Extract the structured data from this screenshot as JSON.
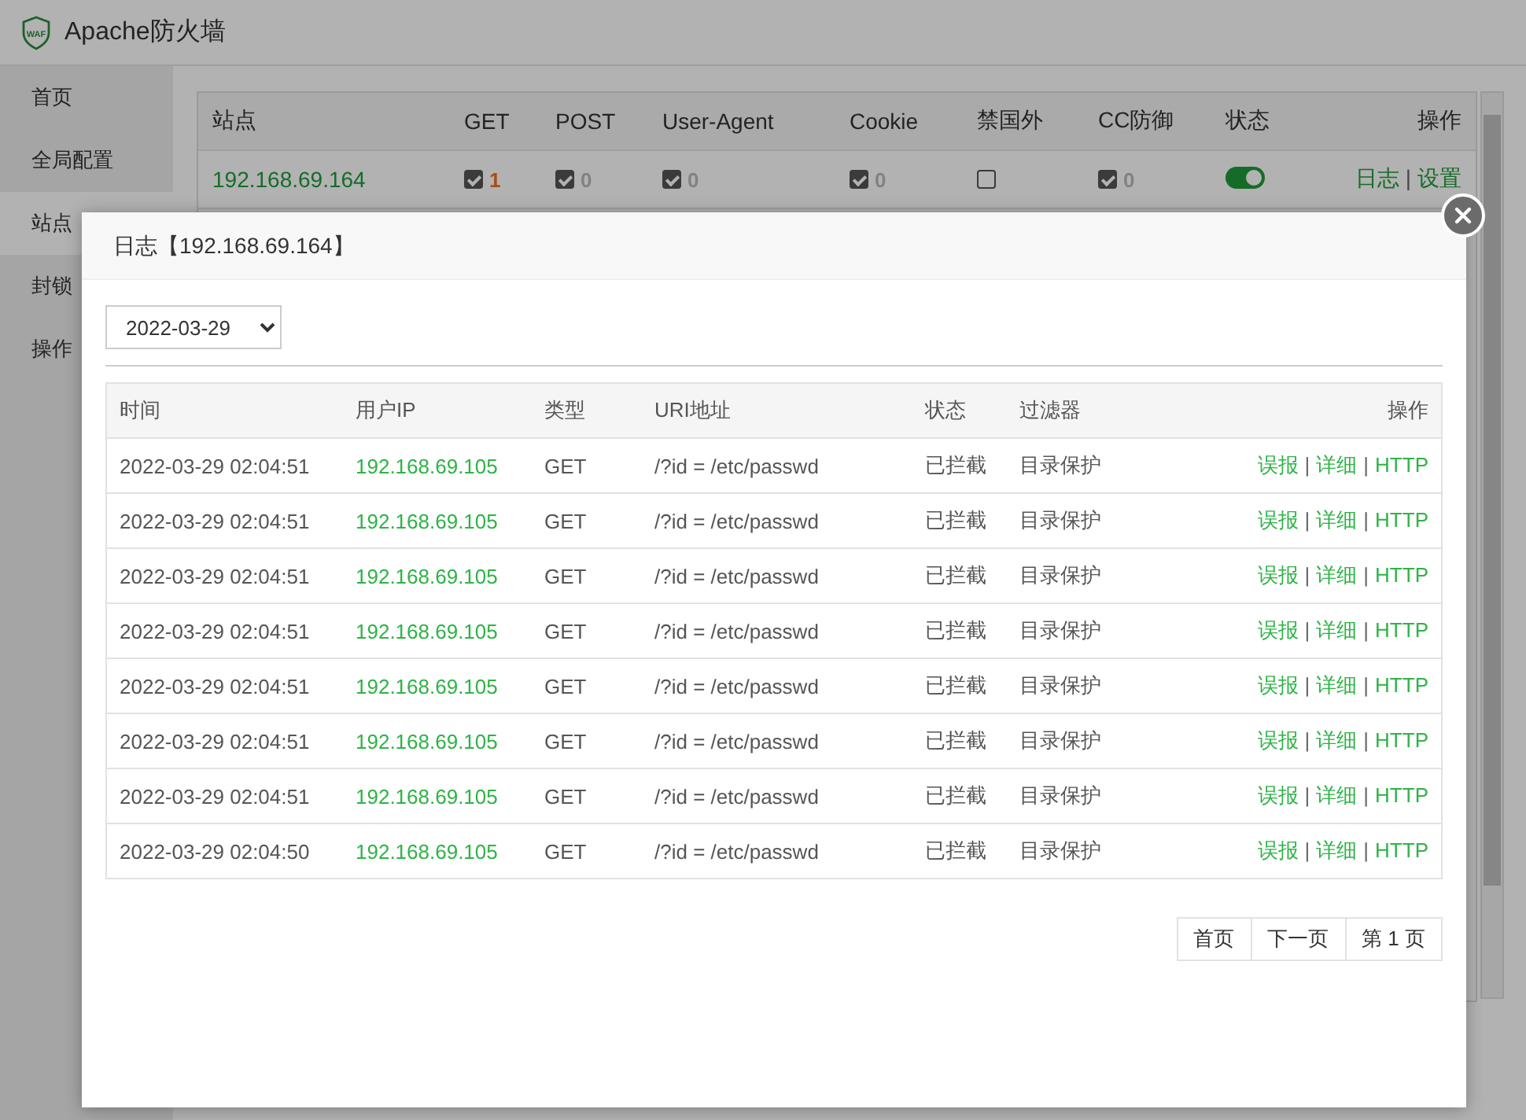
{
  "app": {
    "logo_text": "WAF",
    "title": "Apache防火墙"
  },
  "sidebar": {
    "items": [
      {
        "label": "首页",
        "selected": false
      },
      {
        "label": "全局配置",
        "selected": false
      },
      {
        "label": "站点",
        "selected": true
      },
      {
        "label": "封锁",
        "selected": false
      },
      {
        "label": "操作",
        "selected": false
      }
    ]
  },
  "sites_table": {
    "columns": [
      "站点",
      "GET",
      "POST",
      "User-Agent",
      "Cookie",
      "禁国外",
      "CC防御",
      "状态",
      "操作"
    ],
    "rows": [
      {
        "site": "192.168.69.164",
        "checks": [
          {
            "checked": true,
            "count": "1",
            "highlighted": true
          },
          {
            "checked": true,
            "count": "0",
            "highlighted": false
          },
          {
            "checked": true,
            "count": "0",
            "highlighted": false
          },
          {
            "checked": true,
            "count": "0",
            "highlighted": false
          },
          {
            "checked": false
          },
          {
            "checked": true,
            "count": "0",
            "highlighted": false
          }
        ],
        "enabled": true,
        "actions": [
          {
            "kind": "link",
            "text": "日志"
          },
          {
            "kind": "separator",
            "text": "|"
          },
          {
            "kind": "link",
            "text": "设置"
          }
        ]
      }
    ]
  },
  "dialog": {
    "title": "日志【192.168.69.164】",
    "date": "2022-03-29",
    "columns": [
      "时间",
      "用户IP",
      "类型",
      "URI地址",
      "状态",
      "过滤器",
      "操作"
    ],
    "rows": [
      {
        "time": "2022-03-29 02:04:51",
        "ip": "192.168.69.105",
        "type": "GET",
        "uri": "/?id = /etc/passwd",
        "status": "已拦截",
        "filter": "目录保护",
        "actions": [
          {
            "kind": "link",
            "text": "误报"
          },
          {
            "kind": "separator",
            "text": "|"
          },
          {
            "kind": "link",
            "text": "详细"
          },
          {
            "kind": "separator",
            "text": "|"
          },
          {
            "kind": "link",
            "text": "HTTP"
          }
        ]
      },
      {
        "time": "2022-03-29 02:04:51",
        "ip": "192.168.69.105",
        "type": "GET",
        "uri": "/?id = /etc/passwd",
        "status": "已拦截",
        "filter": "目录保护",
        "actions": [
          {
            "kind": "link",
            "text": "误报"
          },
          {
            "kind": "separator",
            "text": "|"
          },
          {
            "kind": "link",
            "text": "详细"
          },
          {
            "kind": "separator",
            "text": "|"
          },
          {
            "kind": "link",
            "text": "HTTP"
          }
        ]
      },
      {
        "time": "2022-03-29 02:04:51",
        "ip": "192.168.69.105",
        "type": "GET",
        "uri": "/?id = /etc/passwd",
        "status": "已拦截",
        "filter": "目录保护",
        "actions": [
          {
            "kind": "link",
            "text": "误报"
          },
          {
            "kind": "separator",
            "text": "|"
          },
          {
            "kind": "link",
            "text": "详细"
          },
          {
            "kind": "separator",
            "text": "|"
          },
          {
            "kind": "link",
            "text": "HTTP"
          }
        ]
      },
      {
        "time": "2022-03-29 02:04:51",
        "ip": "192.168.69.105",
        "type": "GET",
        "uri": "/?id = /etc/passwd",
        "status": "已拦截",
        "filter": "目录保护",
        "actions": [
          {
            "kind": "link",
            "text": "误报"
          },
          {
            "kind": "separator",
            "text": "|"
          },
          {
            "kind": "link",
            "text": "详细"
          },
          {
            "kind": "separator",
            "text": "|"
          },
          {
            "kind": "link",
            "text": "HTTP"
          }
        ]
      },
      {
        "time": "2022-03-29 02:04:51",
        "ip": "192.168.69.105",
        "type": "GET",
        "uri": "/?id = /etc/passwd",
        "status": "已拦截",
        "filter": "目录保护",
        "actions": [
          {
            "kind": "link",
            "text": "误报"
          },
          {
            "kind": "separator",
            "text": "|"
          },
          {
            "kind": "link",
            "text": "详细"
          },
          {
            "kind": "separator",
            "text": "|"
          },
          {
            "kind": "link",
            "text": "HTTP"
          }
        ]
      },
      {
        "time": "2022-03-29 02:04:51",
        "ip": "192.168.69.105",
        "type": "GET",
        "uri": "/?id = /etc/passwd",
        "status": "已拦截",
        "filter": "目录保护",
        "actions": [
          {
            "kind": "link",
            "text": "误报"
          },
          {
            "kind": "separator",
            "text": "|"
          },
          {
            "kind": "link",
            "text": "详细"
          },
          {
            "kind": "separator",
            "text": "|"
          },
          {
            "kind": "link",
            "text": "HTTP"
          }
        ]
      },
      {
        "time": "2022-03-29 02:04:51",
        "ip": "192.168.69.105",
        "type": "GET",
        "uri": "/?id = /etc/passwd",
        "status": "已拦截",
        "filter": "目录保护",
        "actions": [
          {
            "kind": "link",
            "text": "误报"
          },
          {
            "kind": "separator",
            "text": "|"
          },
          {
            "kind": "link",
            "text": "详细"
          },
          {
            "kind": "separator",
            "text": "|"
          },
          {
            "kind": "link",
            "text": "HTTP"
          }
        ]
      },
      {
        "time": "2022-03-29 02:04:50",
        "ip": "192.168.69.105",
        "type": "GET",
        "uri": "/?id = /etc/passwd",
        "status": "已拦截",
        "filter": "目录保护",
        "actions": [
          {
            "kind": "link",
            "text": "误报"
          },
          {
            "kind": "separator",
            "text": "|"
          },
          {
            "kind": "link",
            "text": "详细"
          },
          {
            "kind": "separator",
            "text": "|"
          },
          {
            "kind": "link",
            "text": "HTTP"
          }
        ]
      }
    ],
    "pagination": [
      "首页",
      "下一页",
      "第 1 页"
    ]
  }
}
